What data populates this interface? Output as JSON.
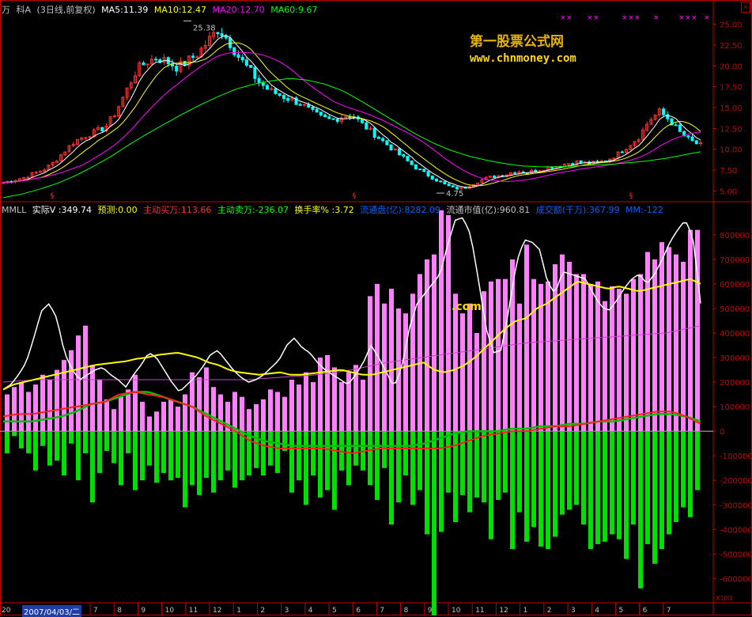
{
  "main_header": {
    "app": "万",
    "stock": "科A",
    "period": "(3日线,前复权)",
    "ma5": "MA5:11.39",
    "ma10": "MA10:12.47",
    "ma20": "MA20:12.70",
    "ma60": "MA60:9.67"
  },
  "indicator_header": {
    "name": "MMLL",
    "actual_v": "实际V :349.74",
    "forecast": "预测:0.00",
    "buy": "主动买万:113.66",
    "sell": "主动卖万:-236.07",
    "turnover": "换手率% :3.72",
    "float_shares": "流通盘(亿):8282.09",
    "float_value": "流通市值(亿):960.81",
    "volume_amount": "成交额(千万):367.99",
    "mm": "MM:-122"
  },
  "watermark": {
    "title": "第一股票公式网",
    "url": "www.chnmoney.com",
    "fragment": ".com"
  },
  "annotations": {
    "high": "25.38",
    "low": "4.75"
  },
  "price_axis": [
    "25.00",
    "22.50",
    "20.00",
    "17.50",
    "15.00",
    "12.50",
    "10.00",
    "7.50",
    "5.00"
  ],
  "volume_axis": [
    "800000",
    "700000",
    "600000",
    "500000",
    "400000",
    "300000",
    "200000",
    "100000",
    "0",
    "-100000",
    "-200000",
    "-300000",
    "-400000",
    "-500000",
    "-600000"
  ],
  "volume_axis_unit": "X100",
  "date_label": "2007/04/03/二",
  "x_left_fragment": "20",
  "x_labels": [
    "7",
    "8",
    "9",
    "10",
    "11",
    "12",
    "1",
    "2",
    "3",
    "4",
    "5",
    "6",
    "7",
    "8",
    "9",
    "10",
    "11",
    "12",
    "1",
    "2",
    "3",
    "4",
    "5",
    "6",
    "7"
  ],
  "colors": {
    "ma5": "#ffffff",
    "ma10": "#ffff00",
    "ma20": "#ff00ff",
    "ma60": "#00ff00",
    "up": "#ff3030",
    "down": "#00ffff",
    "axis": "#c00000",
    "buy": "#ff3030",
    "sell": "#00ff00",
    "turnover": "#ffff00",
    "float": "#0060ff",
    "vol_bar_up": "#ff80ff",
    "vol_bar_dn": "#00e000"
  },
  "chart_data": [
    {
      "type": "candlestick",
      "title": "",
      "ylim": [
        4,
        26
      ],
      "price_points": [
        6.0,
        6.3,
        6.6,
        7.1,
        7.6,
        8.5,
        9.8,
        11.0,
        11.6,
        12.1,
        12.7,
        14.5,
        17.0,
        19.5,
        20.5,
        21.0,
        20.5,
        19.8,
        20.6,
        21.5,
        23.0,
        24.5,
        23.0,
        21.0,
        19.5,
        18.0,
        17.0,
        16.5,
        16.0,
        15.5,
        14.5,
        13.8,
        13.5,
        13.9,
        14.2,
        13.0,
        12.0,
        11.0,
        10.0,
        9.0,
        8.0,
        7.2,
        6.5,
        5.8,
        5.3,
        5.4,
        6.0,
        6.5,
        6.8,
        7.0,
        7.4,
        7.2,
        7.5,
        7.8,
        8.0,
        8.3,
        8.5,
        8.3,
        8.4,
        8.8,
        9.5,
        10.5,
        11.5,
        13.5,
        14.5,
        13.5,
        12.0,
        11.0,
        10.5
      ],
      "ma60_points": [
        4.2,
        4.6,
        5.2,
        5.9,
        6.8,
        7.9,
        9.1,
        10.5,
        11.8,
        13.0,
        14.2,
        15.3,
        16.3,
        17.2,
        17.8,
        18.2,
        18.5,
        18.3,
        17.8,
        17.0,
        15.8,
        14.5,
        13.2,
        11.9,
        10.8,
        9.9,
        9.2,
        8.7,
        8.3,
        8.0,
        7.9,
        7.9,
        8.0,
        8.1,
        8.2,
        8.4,
        8.6,
        8.9,
        9.3,
        9.7
      ],
      "high_label": 25.38,
      "low_label": 4.75
    },
    {
      "type": "bar",
      "title": "",
      "ylim": [
        -660000,
        880000
      ],
      "buy_bars": [
        150,
        180,
        200,
        160,
        190,
        230,
        210,
        250,
        290,
        330,
        390,
        430,
        270,
        210,
        130,
        90,
        140,
        170,
        230,
        120,
        60,
        80,
        120,
        130,
        100,
        150,
        240,
        220,
        260,
        180,
        150,
        120,
        160,
        140,
        90,
        110,
        130,
        170,
        160,
        140,
        210,
        190,
        240,
        200,
        300,
        310,
        260,
        200,
        240,
        270,
        210,
        550,
        600,
        520,
        580,
        500,
        480,
        560,
        640,
        700,
        720,
        900,
        880,
        560,
        480,
        520,
        400,
        570,
        610,
        620,
        620,
        700,
        520,
        760,
        620,
        600,
        610,
        680,
        720,
        690,
        640,
        640,
        600,
        610,
        530,
        590,
        580,
        560,
        620,
        640,
        730,
        700,
        770,
        750,
        720,
        690,
        820,
        820
      ],
      "sell_bars": [
        -90,
        -20,
        -70,
        -90,
        -160,
        -60,
        -140,
        -120,
        -180,
        -50,
        -200,
        -90,
        -290,
        -170,
        -80,
        -130,
        -220,
        -90,
        -240,
        -200,
        -140,
        -210,
        -170,
        -200,
        -190,
        -310,
        -220,
        -260,
        -190,
        -250,
        -200,
        -160,
        -230,
        -200,
        -180,
        -150,
        -180,
        -140,
        -170,
        -80,
        -250,
        -200,
        -300,
        -180,
        -270,
        -240,
        -320,
        -160,
        -220,
        -140,
        -160,
        -220,
        -280,
        -150,
        -380,
        -290,
        -180,
        -300,
        -240,
        -420,
        -760,
        -410,
        -250,
        -370,
        -260,
        -330,
        -270,
        -290,
        -440,
        -280,
        -250,
        -480,
        -330,
        -450,
        -390,
        -470,
        -480,
        -430,
        -340,
        -320,
        -300,
        -380,
        -480,
        -460,
        -450,
        -420,
        -440,
        -520,
        -380,
        -640,
        -460,
        -540,
        -480,
        -420,
        -370,
        -310,
        -350,
        -240
      ],
      "white_line": [
        170,
        190,
        230,
        280,
        380,
        490,
        520,
        460,
        320,
        250,
        210,
        230,
        250,
        260,
        230,
        210,
        180,
        230,
        270,
        320,
        300,
        250,
        200,
        160,
        190,
        220,
        260,
        310,
        330,
        290,
        250,
        220,
        200,
        210,
        230,
        260,
        290,
        350,
        380,
        340,
        320,
        280,
        250,
        230,
        210,
        190,
        230,
        280,
        350,
        300,
        240,
        180,
        260,
        420,
        520,
        560,
        600,
        640,
        760,
        860,
        870,
        800,
        620,
        420,
        320,
        330,
        500,
        690,
        780,
        770,
        740,
        610,
        560,
        650,
        640,
        630,
        620,
        560,
        510,
        490,
        530,
        580,
        620,
        640,
        600,
        640,
        700,
        770,
        820,
        860,
        790,
        520
      ],
      "yellow_line": [
        170,
        190,
        200,
        210,
        220,
        230,
        240,
        250,
        260,
        270,
        275,
        280,
        285,
        295,
        300,
        310,
        315,
        320,
        310,
        300,
        280,
        270,
        250,
        240,
        235,
        230,
        235,
        240,
        230,
        230,
        235,
        240,
        245,
        250,
        240,
        230,
        230,
        240,
        250,
        260,
        270,
        280,
        250,
        240,
        250,
        270,
        300,
        340,
        380,
        420,
        450,
        460,
        500,
        520,
        550,
        580,
        610,
        600,
        590,
        580,
        590,
        580,
        570,
        580,
        590,
        600,
        610,
        620,
        600
      ],
      "red_line": [
        60,
        70,
        70,
        80,
        90,
        100,
        110,
        120,
        150,
        160,
        150,
        140,
        120,
        100,
        60,
        30,
        0,
        -40,
        -60,
        -70,
        -70,
        -70,
        -70,
        -80,
        -90,
        -80,
        -70,
        -70,
        -70,
        -70,
        -70,
        -60,
        -40,
        -20,
        -10,
        0,
        0,
        10,
        20,
        20,
        30,
        40,
        50,
        60,
        70,
        80,
        80,
        60,
        30
      ],
      "green_line": [
        40,
        40,
        40,
        50,
        60,
        80,
        110,
        120,
        140,
        160,
        160,
        140,
        120,
        100,
        70,
        40,
        10,
        -20,
        -40,
        -50,
        -60,
        -60,
        -60,
        -60,
        -60,
        -60,
        -60,
        -60,
        -60,
        -50,
        -30,
        -10,
        0,
        0,
        0,
        10,
        10,
        20,
        20,
        30,
        30,
        40,
        40,
        50,
        60,
        70,
        70,
        60,
        40
      ],
      "magenta_line": [
        200,
        210,
        210,
        210,
        210,
        210,
        210,
        210,
        220,
        230,
        250,
        280,
        300,
        320,
        340,
        360,
        370,
        380,
        390,
        400,
        430
      ]
    }
  ]
}
